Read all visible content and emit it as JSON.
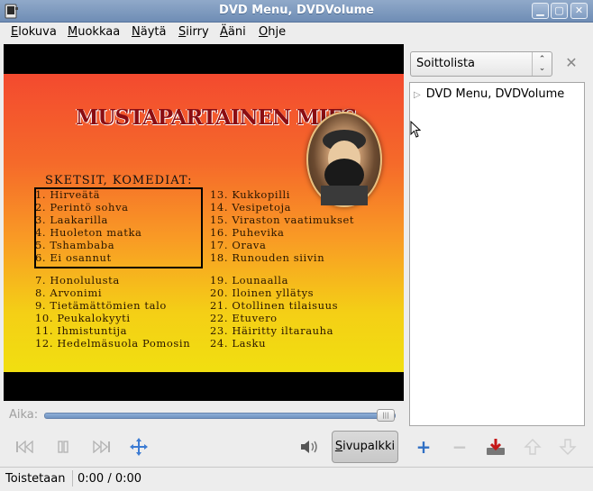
{
  "window": {
    "title": "DVD Menu, DVDVolume"
  },
  "menu": [
    {
      "label": "Elokuva",
      "key": "E"
    },
    {
      "label": "Muokkaa",
      "key": "M"
    },
    {
      "label": "Näytä",
      "key": "N"
    },
    {
      "label": "Siirry",
      "key": "S"
    },
    {
      "label": "Ääni",
      "key": "Ä"
    },
    {
      "label": "Ohje",
      "key": "O"
    }
  ],
  "video": {
    "title": "MUSTAPARTAINEN MIES",
    "section": "SKETSIT, KOMEDIAT:",
    "episodes_left": [
      "1. Hirveätä",
      "2. Perintö sohva",
      "3. Laakarilla",
      "4. Huoleton matka",
      "5. Tshambaba",
      "6. Ei osannut",
      "7. Honolulusta",
      "8. Arvonimi",
      "9. Tietämättömien talo",
      "10. Peukalokyyti",
      "11. Ihmistuntija",
      "12. Hedelmäsuola Pomosin"
    ],
    "episodes_right": [
      "13. Kukkopilli",
      "14. Vesipetoja",
      "15. Viraston vaatimukset",
      "16. Puhevika",
      "17. Orava",
      "18. Runouden siivin",
      "19. Lounaalla",
      "20. Iloinen yllätys",
      "21. Otollinen tilaisuus",
      "22. Etuvero",
      "23. Häiritty iltarauha",
      "24. Lasku"
    ]
  },
  "sidebar": {
    "selector": "Soittolista",
    "items": [
      {
        "label": "DVD Menu, DVDVolume"
      }
    ]
  },
  "time": {
    "label": "Aika:",
    "position": 0.97
  },
  "controls": {
    "sidebar_button": "Sivupalkki",
    "sidebar_key": "S",
    "sidebar_rest": "ivupalkki"
  },
  "status": {
    "state": "Toistetaan",
    "time": "0:00 / 0:00"
  },
  "colors": {
    "titlebar": "#7f9cc2",
    "accent": "#2f6fc4",
    "remove_red": "#c41818"
  }
}
